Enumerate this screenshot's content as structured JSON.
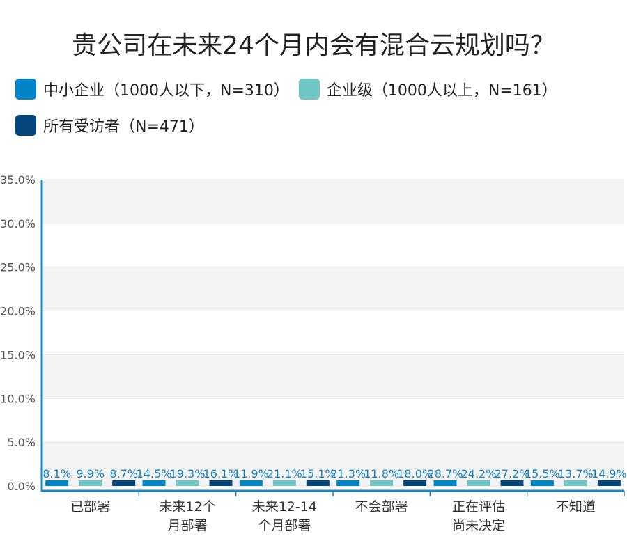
{
  "chart_data": {
    "type": "bar",
    "title": "贵公司在未来24个月内会有混合云规划吗？",
    "categories": [
      "已部署",
      "未来12个\n月部署",
      "未来12-14\n个月部署",
      "不会部署",
      "正在评估\n尚未决定",
      "不知道"
    ],
    "series": [
      {
        "name": "中小企业（1000人以下，N=310）",
        "color": "#0084c8",
        "values": [
          8.1,
          14.5,
          11.9,
          21.3,
          28.7,
          15.5
        ],
        "labels": [
          "8.1%",
          "14.5%",
          "11.9%",
          "21.3%",
          "28.7%",
          "15.5%"
        ]
      },
      {
        "name": "企业级（1000人以上，N=161）",
        "color": "#6fc6c3",
        "values": [
          9.9,
          19.3,
          21.1,
          11.8,
          24.2,
          13.7
        ],
        "labels": [
          "9.9%",
          "19.3%",
          "21.1%",
          "11.8%",
          "24.2%",
          "13.7%"
        ]
      },
      {
        "name": "所有受访者（N=471）",
        "color": "#04467c",
        "values": [
          8.7,
          16.1,
          15.1,
          18.0,
          27.2,
          14.9
        ],
        "labels": [
          "8.7%",
          "16.1%",
          "15.1%",
          "18.0%",
          "27.2%",
          "14.9%"
        ]
      }
    ],
    "yticks": [
      "0.0%",
      "5.0%",
      "10.0%",
      "15.0%",
      "20.0%",
      "25.0%",
      "30.0%",
      "35.0%"
    ],
    "ylim": [
      0,
      35
    ],
    "grid": true,
    "legend_position": "top-left"
  }
}
